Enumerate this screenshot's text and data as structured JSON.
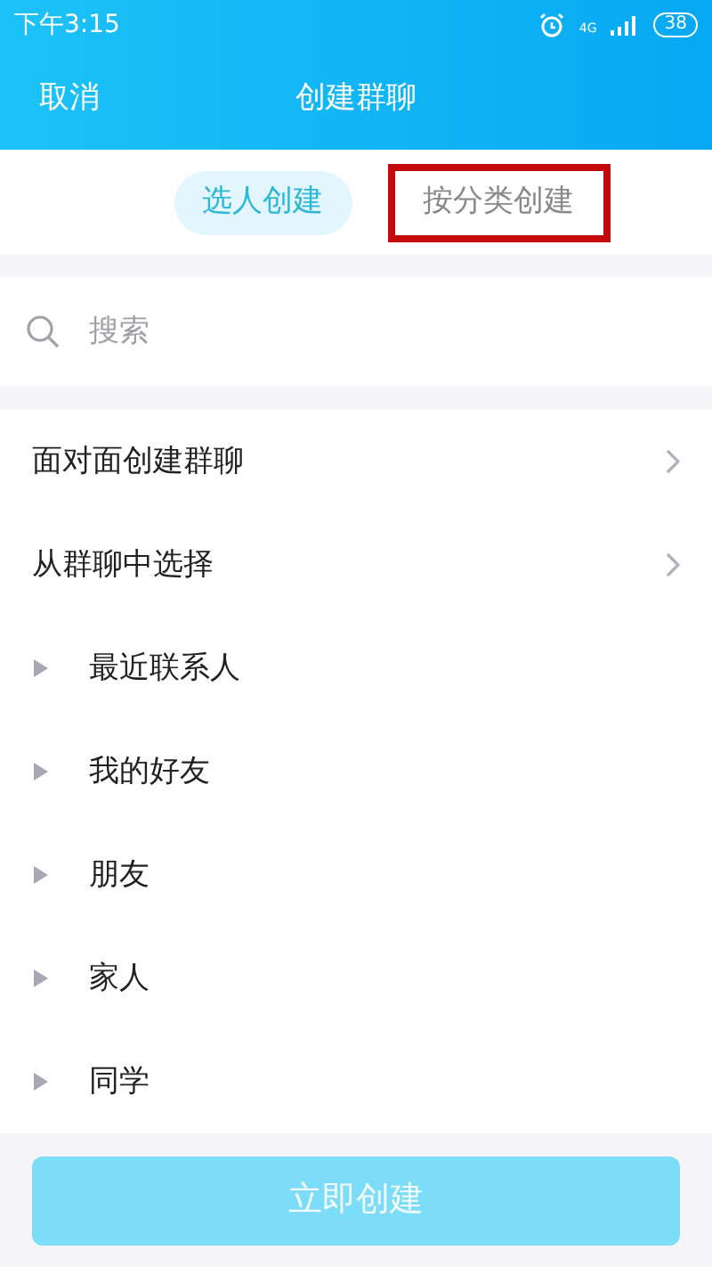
{
  "status_bar": {
    "time": "下午3:15",
    "network": "4G",
    "battery": "38"
  },
  "header": {
    "cancel": "取消",
    "title": "创建群聊"
  },
  "tabs": [
    {
      "label": "选人创建",
      "selected": true,
      "highlighted": false
    },
    {
      "label": "按分类创建",
      "selected": false,
      "highlighted": true
    }
  ],
  "search": {
    "placeholder": "搜索"
  },
  "list": [
    {
      "kind": "link",
      "label": "面对面创建群聊"
    },
    {
      "kind": "link",
      "label": "从群聊中选择"
    },
    {
      "kind": "group",
      "label": "最近联系人",
      "expanded": false
    },
    {
      "kind": "group",
      "label": "我的好友",
      "expanded": false
    },
    {
      "kind": "group",
      "label": "朋友",
      "expanded": false
    },
    {
      "kind": "group",
      "label": "家人",
      "expanded": false
    },
    {
      "kind": "group",
      "label": "同学",
      "expanded": false
    }
  ],
  "create_button": {
    "label": "立即创建",
    "disabled": true
  }
}
